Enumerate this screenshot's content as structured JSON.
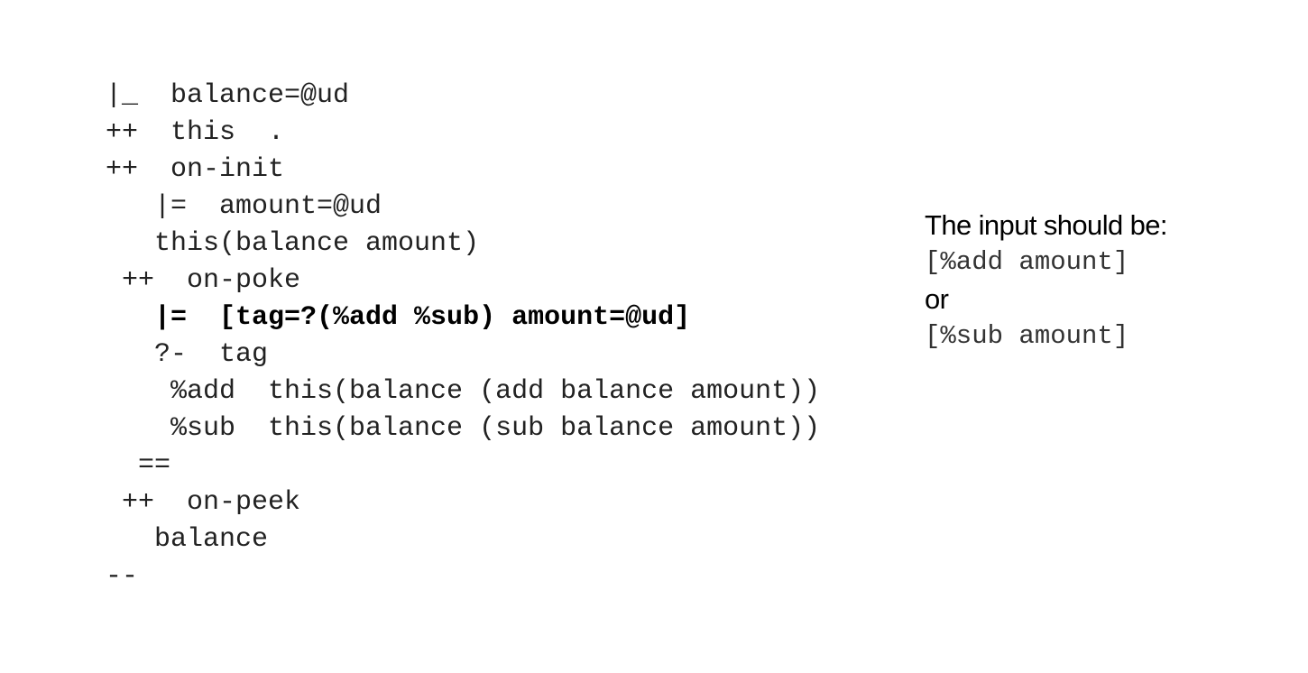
{
  "code": {
    "lines": [
      {
        "text": "|_  balance=@ud",
        "bold": false
      },
      {
        "text": "++  this  .",
        "bold": false
      },
      {
        "text": "++  on-init",
        "bold": false
      },
      {
        "text": "   |=  amount=@ud",
        "bold": false
      },
      {
        "text": "   this(balance amount)",
        "bold": false
      },
      {
        "text": " ++  on-poke",
        "bold": false
      },
      {
        "text": "   |=  [tag=?(%add %sub) amount=@ud]",
        "bold": true
      },
      {
        "text": "   ?-  tag",
        "bold": false
      },
      {
        "text": "    %add  this(balance (add balance amount))",
        "bold": false
      },
      {
        "text": "    %sub  this(balance (sub balance amount))",
        "bold": false
      },
      {
        "text": "  ==",
        "bold": false
      },
      {
        "text": " ++  on-peek",
        "bold": false
      },
      {
        "text": "   balance",
        "bold": false
      },
      {
        "text": "--",
        "bold": false
      }
    ]
  },
  "note": {
    "heading": "The input should be:",
    "option_add": "[%add amount]",
    "or_label": "or",
    "option_sub": "[%sub amount]"
  }
}
